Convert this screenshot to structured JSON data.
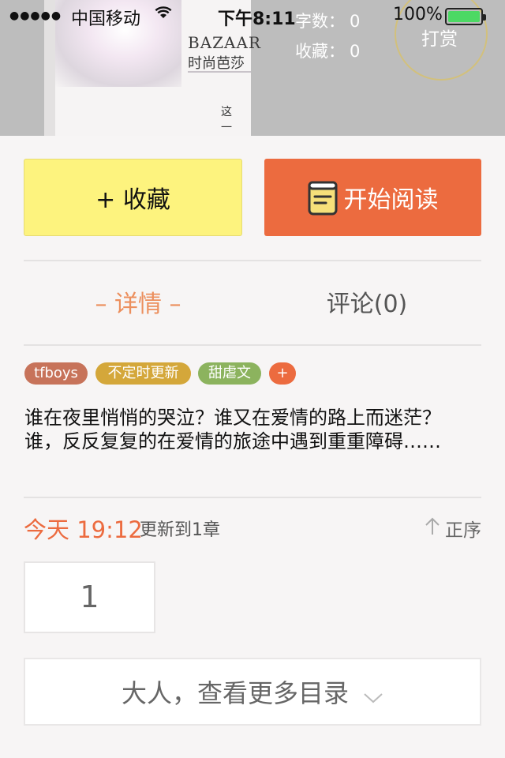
{
  "status_bar": {
    "signal": "●●●●●",
    "carrier": "中国移动",
    "time": "下午8:11",
    "battery_pct": "100%",
    "battery_level": 1.0,
    "battery_color": "#4cd964"
  },
  "book": {
    "cover": {
      "brand": "BAZAAR",
      "brand_cn": "时尚芭莎",
      "corner_text": "这一刻"
    },
    "stats": {
      "words_label": "字数：",
      "words_value": "0",
      "favorites_label": "收藏：",
      "favorites_value": "0"
    },
    "tip_label": "打赏"
  },
  "actions": {
    "collect_label": "+ 收藏",
    "read_label": "开始阅读",
    "collect_color": "#fdf37e",
    "read_color": "#ec6b3f"
  },
  "tabs": {
    "detail": "– 详情 –",
    "comment": "评论(0)"
  },
  "tags": [
    {
      "label": "tfboys",
      "color": "#c7735a"
    },
    {
      "label": "不定时更新",
      "color": "#d4a73a"
    },
    {
      "label": "甜虐文",
      "color": "#8cb35e"
    },
    {
      "label": "+",
      "color": "#ec6b3f"
    }
  ],
  "description": "谁在夜里悄悄的哭泣？谁又在爱情的路上而迷茫？谁，反反复复的在爱情的旅途中遇到重重障碍……",
  "update": {
    "date": "今天 19:12",
    "info": "更新到1章",
    "sort_label": "正序"
  },
  "chapters": [
    "1"
  ],
  "more_label": "大人，查看更多目录"
}
